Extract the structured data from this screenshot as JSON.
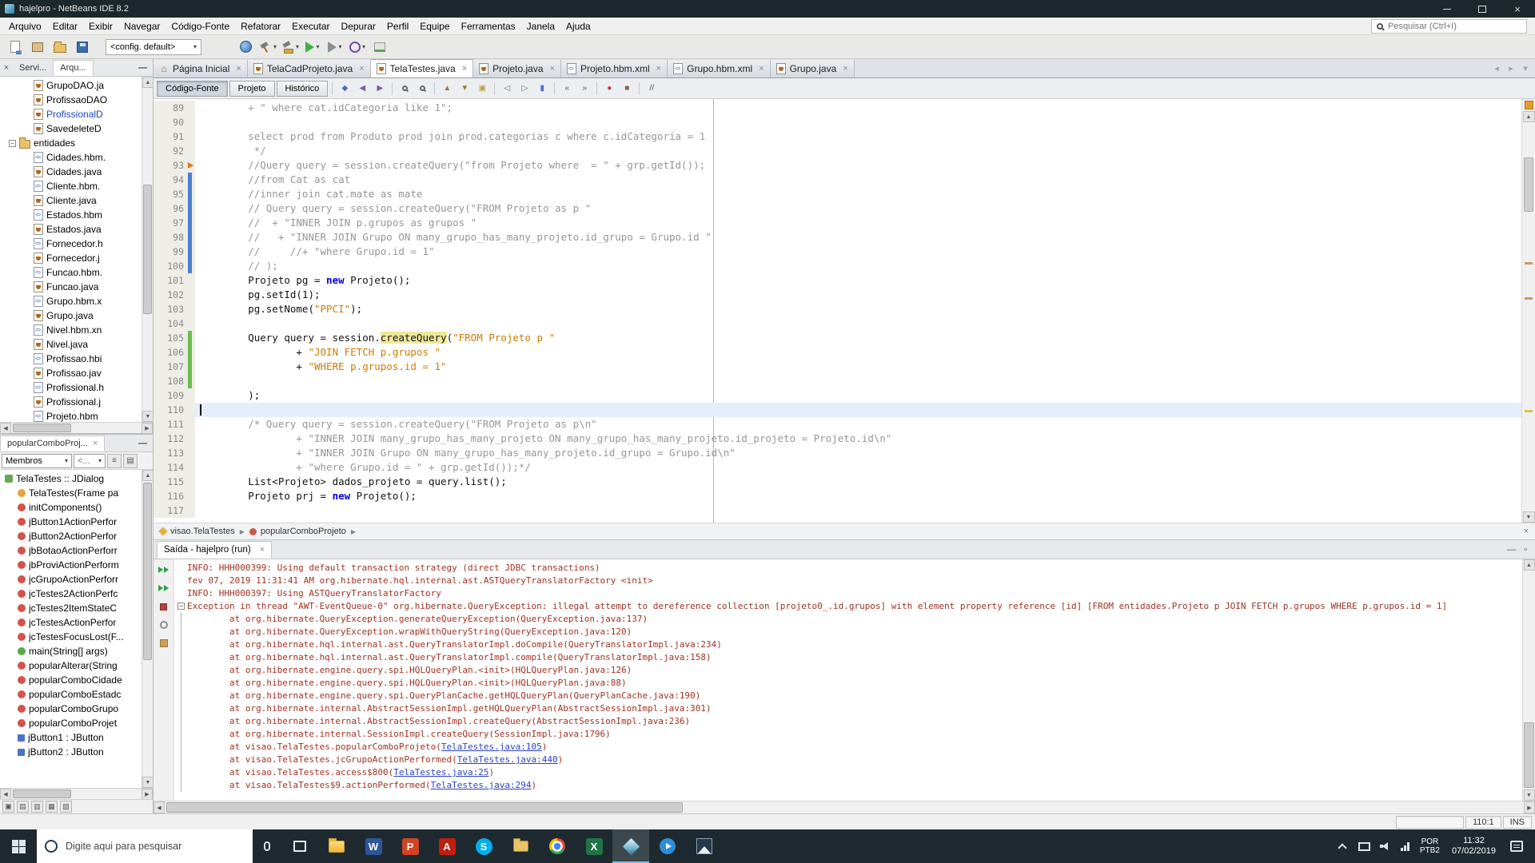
{
  "window": {
    "title": "hajelpro - NetBeans IDE 8.2"
  },
  "menu": {
    "items": [
      "Arquivo",
      "Editar",
      "Exibir",
      "Navegar",
      "Código-Fonte",
      "Refatorar",
      "Executar",
      "Depurar",
      "Perfil",
      "Equipe",
      "Ferramentas",
      "Janela",
      "Ajuda"
    ],
    "search_placeholder": "Pesquisar (Ctrl+I)"
  },
  "toolbar": {
    "config_value": "<config. default>",
    "icons_left": [
      "new-file",
      "new-project",
      "open-project",
      "save-all"
    ],
    "icons_right": [
      {
        "name": "globe"
      },
      {
        "name": "build",
        "arrow": true
      },
      {
        "name": "clean-build",
        "arrow": true
      },
      {
        "name": "run",
        "arrow": true
      },
      {
        "name": "debug",
        "arrow": true
      },
      {
        "name": "profile",
        "arrow": true
      },
      {
        "name": "memory-gauge"
      }
    ]
  },
  "projects_panel": {
    "tabs": [
      "Servi...",
      "Arqu..."
    ],
    "active_tab": 1,
    "items": [
      {
        "label": "GrupoDAO.ja",
        "icon": "java",
        "indent": 2
      },
      {
        "label": "ProfissaoDAO",
        "icon": "java",
        "indent": 2
      },
      {
        "label": "ProfissionalD",
        "icon": "java",
        "indent": 2,
        "color": "blue"
      },
      {
        "label": "SavedeleteD",
        "icon": "java",
        "indent": 2
      },
      {
        "label": "entidades",
        "icon": "folder",
        "indent": 1,
        "expanded": true
      },
      {
        "label": "Cidades.hbm.",
        "icon": "xml",
        "indent": 2
      },
      {
        "label": "Cidades.java",
        "icon": "java",
        "indent": 2
      },
      {
        "label": "Cliente.hbm.",
        "icon": "xml",
        "indent": 2
      },
      {
        "label": "Cliente.java",
        "icon": "java",
        "indent": 2
      },
      {
        "label": "Estados.hbm",
        "icon": "xml",
        "indent": 2
      },
      {
        "label": "Estados.java",
        "icon": "java",
        "indent": 2
      },
      {
        "label": "Fornecedor.h",
        "icon": "xml",
        "indent": 2
      },
      {
        "label": "Fornecedor.j",
        "icon": "java",
        "indent": 2
      },
      {
        "label": "Funcao.hbm.",
        "icon": "xml",
        "indent": 2
      },
      {
        "label": "Funcao.java",
        "icon": "java",
        "indent": 2
      },
      {
        "label": "Grupo.hbm.x",
        "icon": "xml",
        "indent": 2
      },
      {
        "label": "Grupo.java",
        "icon": "java",
        "indent": 2
      },
      {
        "label": "Nivel.hbm.xn",
        "icon": "xml",
        "indent": 2
      },
      {
        "label": "Nivel.java",
        "icon": "java",
        "indent": 2
      },
      {
        "label": "Profissao.hbi",
        "icon": "xml",
        "indent": 2
      },
      {
        "label": "Profissao.jav",
        "icon": "java",
        "indent": 2
      },
      {
        "label": "Profissional.h",
        "icon": "xml",
        "indent": 2
      },
      {
        "label": "Profissional.j",
        "icon": "java",
        "indent": 2
      },
      {
        "label": "Projeto.hbm",
        "icon": "xml",
        "indent": 2
      }
    ]
  },
  "navigator": {
    "tab_label": "popularComboProj...",
    "filter_label": "Membros",
    "filter2_label": "<...",
    "items": [
      {
        "label": "TelaTestes :: JDialog",
        "icon": "class",
        "indent": 0
      },
      {
        "label": "TelaTestes(Frame pa",
        "icon": "ctor",
        "indent": 1
      },
      {
        "label": "initComponents()",
        "icon": "priv",
        "indent": 1
      },
      {
        "label": "jButton1ActionPerfor",
        "icon": "priv",
        "indent": 1
      },
      {
        "label": "jButton2ActionPerfor",
        "icon": "priv",
        "indent": 1
      },
      {
        "label": "jbBotaoActionPerforr",
        "icon": "priv",
        "indent": 1
      },
      {
        "label": "jbProviActionPerform",
        "icon": "priv",
        "indent": 1
      },
      {
        "label": "jcGrupoActionPerforr",
        "icon": "priv",
        "indent": 1
      },
      {
        "label": "jcTestes2ActionPerfc",
        "icon": "priv",
        "indent": 1
      },
      {
        "label": "jcTestes2ItemStateC",
        "icon": "priv",
        "indent": 1
      },
      {
        "label": "jcTestesActionPerfor",
        "icon": "priv",
        "indent": 1
      },
      {
        "label": "jcTestesFocusLost(F...",
        "icon": "priv",
        "indent": 1
      },
      {
        "label": "main(String[] args)",
        "icon": "pub",
        "indent": 1
      },
      {
        "label": "popularAlterar(String",
        "icon": "priv",
        "indent": 1
      },
      {
        "label": "popularComboCidade",
        "icon": "priv",
        "indent": 1
      },
      {
        "label": "popularComboEstadc",
        "icon": "priv",
        "indent": 1
      },
      {
        "label": "popularComboGrupo",
        "icon": "priv",
        "indent": 1
      },
      {
        "label": "popularComboProjet",
        "icon": "priv",
        "indent": 1
      },
      {
        "label": "jButton1 : JButton",
        "icon": "field",
        "indent": 1
      },
      {
        "label": "jButton2 : JButton",
        "icon": "field",
        "indent": 1
      }
    ]
  },
  "editor": {
    "tabs": [
      {
        "label": "Página Inicial",
        "icon": "home"
      },
      {
        "label": "TelaCadProjeto.java",
        "icon": "java"
      },
      {
        "label": "TelaTestes.java",
        "icon": "java",
        "active": true
      },
      {
        "label": "Projeto.java",
        "icon": "java"
      },
      {
        "label": "Projeto.hbm.xml",
        "icon": "xml"
      },
      {
        "label": "Grupo.hbm.xml",
        "icon": "xml"
      },
      {
        "label": "Grupo.java",
        "icon": "java"
      }
    ],
    "views": [
      {
        "label": "Código-Fonte",
        "active": true
      },
      {
        "label": "Projeto"
      },
      {
        "label": "Histórico"
      }
    ],
    "toolbar_icons": [
      "last-edit",
      "back",
      "forward",
      "sep",
      "find",
      "find-selection",
      "sep",
      "prev-occurrence",
      "next-occurrence",
      "toggle-highlight",
      "sep",
      "prev-bookmark",
      "next-bookmark",
      "toggle-bookmark",
      "sep",
      "shift-left",
      "shift-right",
      "sep",
      "start-macro",
      "stop-macro",
      "sep",
      "comment"
    ],
    "current_line": 110,
    "breadcrumb": [
      {
        "label": "visao.TelaTestes",
        "icon": "class"
      },
      {
        "label": "popularComboProjeto",
        "icon": "method"
      }
    ],
    "lines": [
      {
        "n": 89,
        "seg": [
          [
            "c",
            "        + \" where cat.idCategoria like 1\";"
          ]
        ]
      },
      {
        "n": 90,
        "seg": []
      },
      {
        "n": 91,
        "seg": [
          [
            "c",
            "        select prod from Produto prod join prod.categorias c where c.idCategoria = 1"
          ]
        ]
      },
      {
        "n": 92,
        "seg": [
          [
            "c",
            "         */"
          ]
        ]
      },
      {
        "n": 93,
        "gicon": "arrow",
        "seg": [
          [
            "c",
            "        //Query query = session.createQuery(\"from Projeto where  = \" + grp.getId());"
          ]
        ]
      },
      {
        "n": 94,
        "vc": "blue",
        "seg": [
          [
            "c",
            "        //from Cat as cat"
          ]
        ]
      },
      {
        "n": 95,
        "vc": "blue",
        "seg": [
          [
            "c",
            "        //inner join cat.mate as mate"
          ]
        ]
      },
      {
        "n": 96,
        "vc": "blue",
        "seg": [
          [
            "c",
            "        // Query query = session.createQuery(\"FROM Projeto as p \""
          ]
        ]
      },
      {
        "n": 97,
        "vc": "blue",
        "seg": [
          [
            "c",
            "        //  + \"INNER JOIN p.grupos as grupos \""
          ]
        ]
      },
      {
        "n": 98,
        "vc": "blue",
        "seg": [
          [
            "c",
            "        //   + \"INNER JOIN Grupo ON many_grupo_has_many_projeto.id_grupo = Grupo.id \""
          ]
        ]
      },
      {
        "n": 99,
        "vc": "blue",
        "seg": [
          [
            "c",
            "        //     //+ \"where Grupo.id = 1\""
          ]
        ]
      },
      {
        "n": 100,
        "vc": "blue",
        "seg": [
          [
            "c",
            "        // );"
          ]
        ]
      },
      {
        "n": 101,
        "seg": [
          [
            "p",
            "        Projeto pg = "
          ],
          [
            "k",
            "new"
          ],
          [
            "p",
            " Projeto();"
          ]
        ]
      },
      {
        "n": 102,
        "seg": [
          [
            "p",
            "        pg.setId(1);"
          ]
        ]
      },
      {
        "n": 103,
        "seg": [
          [
            "p",
            "        pg.setNome("
          ],
          [
            "s",
            "\"PPCI\""
          ],
          [
            "p",
            ");"
          ]
        ]
      },
      {
        "n": 104,
        "seg": []
      },
      {
        "n": 105,
        "vc": "green",
        "seg": [
          [
            "p",
            "        Query query = session."
          ],
          [
            "h",
            "createQuery"
          ],
          [
            "p",
            "("
          ],
          [
            "s",
            "\"FROM Projeto p \""
          ]
        ]
      },
      {
        "n": 106,
        "vc": "green",
        "seg": [
          [
            "p",
            "                + "
          ],
          [
            "s",
            "\"JOIN FETCH p.grupos \""
          ]
        ]
      },
      {
        "n": 107,
        "vc": "green",
        "seg": [
          [
            "p",
            "                + "
          ],
          [
            "s",
            "\"WHERE p.grupos.id = 1\""
          ]
        ]
      },
      {
        "n": 108,
        "vc": "green",
        "seg": []
      },
      {
        "n": 109,
        "seg": [
          [
            "p",
            "        );"
          ]
        ]
      },
      {
        "n": 110,
        "seg": []
      },
      {
        "n": 111,
        "seg": [
          [
            "c",
            "        /* Query query = session.createQuery(\"FROM Projeto as p\\n\""
          ]
        ]
      },
      {
        "n": 112,
        "seg": [
          [
            "c",
            "                + \"INNER JOIN many_grupo_has_many_projeto ON many_grupo_has_many_projeto.id_projeto = Projeto.id\\n\""
          ]
        ]
      },
      {
        "n": 113,
        "seg": [
          [
            "c",
            "                + \"INNER JOIN Grupo ON many_grupo_has_many_projeto.id_grupo = Grupo.id\\n\""
          ]
        ]
      },
      {
        "n": 114,
        "seg": [
          [
            "c",
            "                + \"where Grupo.id = \" + grp.getId());*/"
          ]
        ]
      },
      {
        "n": 115,
        "seg": [
          [
            "p",
            "        List<Projeto> dados_projeto = query.list();"
          ]
        ]
      },
      {
        "n": 116,
        "seg": [
          [
            "p",
            "        Projeto prj = "
          ],
          [
            "k",
            "new"
          ],
          [
            "p",
            " Projeto();"
          ]
        ]
      },
      {
        "n": 117,
        "seg": []
      }
    ]
  },
  "output": {
    "tab_label": "Saída - hajelpro (run)",
    "lines": [
      {
        "seg": [
          [
            "e",
            "INFO: HHH000399: Using default transaction strategy (direct JDBC transactions)"
          ]
        ]
      },
      {
        "seg": [
          [
            "e",
            "fev 07, 2019 11:31:41 AM org.hibernate.hql.internal.ast.ASTQueryTranslatorFactory <init>"
          ]
        ]
      },
      {
        "seg": [
          [
            "e",
            "INFO: HHH000397: Using ASTQueryTranslatorFactory"
          ]
        ]
      },
      {
        "fold": "start",
        "seg": [
          [
            "e",
            "Exception in thread \"AWT-EventQueue-0\" org.hibernate.QueryException: illegal attempt to dereference collection [projeto0_.id.grupos] with element property reference [id] [FROM entidades.Projeto p JOIN FETCH p.grupos WHERE p.grupos.id = 1]"
          ]
        ]
      },
      {
        "fold": "in",
        "seg": [
          [
            "e",
            "        at org.hibernate.QueryException.generateQueryException(QueryException.java:137)"
          ]
        ]
      },
      {
        "fold": "in",
        "seg": [
          [
            "e",
            "        at org.hibernate.QueryException.wrapWithQueryString(QueryException.java:120)"
          ]
        ]
      },
      {
        "fold": "in",
        "seg": [
          [
            "e",
            "        at org.hibernate.hql.internal.ast.QueryTranslatorImpl.doCompile(QueryTranslatorImpl.java:234)"
          ]
        ]
      },
      {
        "fold": "in",
        "seg": [
          [
            "e",
            "        at org.hibernate.hql.internal.ast.QueryTranslatorImpl.compile(QueryTranslatorImpl.java:158)"
          ]
        ]
      },
      {
        "fold": "in",
        "seg": [
          [
            "e",
            "        at org.hibernate.engine.query.spi.HQLQueryPlan.<init>(HQLQueryPlan.java:126)"
          ]
        ]
      },
      {
        "fold": "in",
        "seg": [
          [
            "e",
            "        at org.hibernate.engine.query.spi.HQLQueryPlan.<init>(HQLQueryPlan.java:88)"
          ]
        ]
      },
      {
        "fold": "in",
        "seg": [
          [
            "e",
            "        at org.hibernate.engine.query.spi.QueryPlanCache.getHQLQueryPlan(QueryPlanCache.java:190)"
          ]
        ]
      },
      {
        "fold": "in",
        "seg": [
          [
            "e",
            "        at org.hibernate.internal.AbstractSessionImpl.getHQLQueryPlan(AbstractSessionImpl.java:301)"
          ]
        ]
      },
      {
        "fold": "in",
        "seg": [
          [
            "e",
            "        at org.hibernate.internal.AbstractSessionImpl.createQuery(AbstractSessionImpl.java:236)"
          ]
        ]
      },
      {
        "fold": "in",
        "seg": [
          [
            "e",
            "        at org.hibernate.internal.SessionImpl.createQuery(SessionImpl.java:1796)"
          ]
        ]
      },
      {
        "fold": "in",
        "seg": [
          [
            "e",
            "        at visao.TelaTestes.popularComboProjeto("
          ],
          [
            "l",
            "TelaTestes.java:105"
          ],
          [
            "e",
            ")"
          ]
        ]
      },
      {
        "fold": "in",
        "seg": [
          [
            "e",
            "        at visao.TelaTestes.jcGrupoActionPerformed("
          ],
          [
            "l",
            "TelaTestes.java:440"
          ],
          [
            "e",
            ")"
          ]
        ]
      },
      {
        "fold": "in",
        "seg": [
          [
            "e",
            "        at visao.TelaTestes.access$800("
          ],
          [
            "l",
            "TelaTestes.java:25"
          ],
          [
            "e",
            ")"
          ]
        ]
      },
      {
        "fold": "in",
        "seg": [
          [
            "e",
            "        at visao.TelaTestes$9.actionPerformed("
          ],
          [
            "l",
            "TelaTestes.java:294"
          ],
          [
            "e",
            ")"
          ]
        ]
      }
    ]
  },
  "status": {
    "caret_position": "110:1",
    "insert_mode": "INS"
  },
  "taskbar": {
    "search_placeholder": "Digite aqui para pesquisar",
    "apps": [
      {
        "name": "task-view"
      },
      {
        "name": "file-explorer"
      },
      {
        "name": "word",
        "letter": "W",
        "color": "#2b579a"
      },
      {
        "name": "powerpoint",
        "letter": "P",
        "color": "#d04423"
      },
      {
        "name": "acrobat",
        "letter": "A",
        "color": "#c11e0e"
      },
      {
        "name": "skype",
        "letter": "S",
        "color": "#00aff0",
        "shape": "circle"
      },
      {
        "name": "folder"
      },
      {
        "name": "chrome"
      },
      {
        "name": "excel",
        "letter": "X",
        "color": "#217346"
      },
      {
        "name": "netbeans",
        "active": true
      },
      {
        "name": "media-player"
      },
      {
        "name": "photos"
      }
    ],
    "tray": {
      "lang_line1": "POR",
      "lang_line2": "PTB2",
      "time": "11:32",
      "date": "07/02/2019"
    }
  }
}
